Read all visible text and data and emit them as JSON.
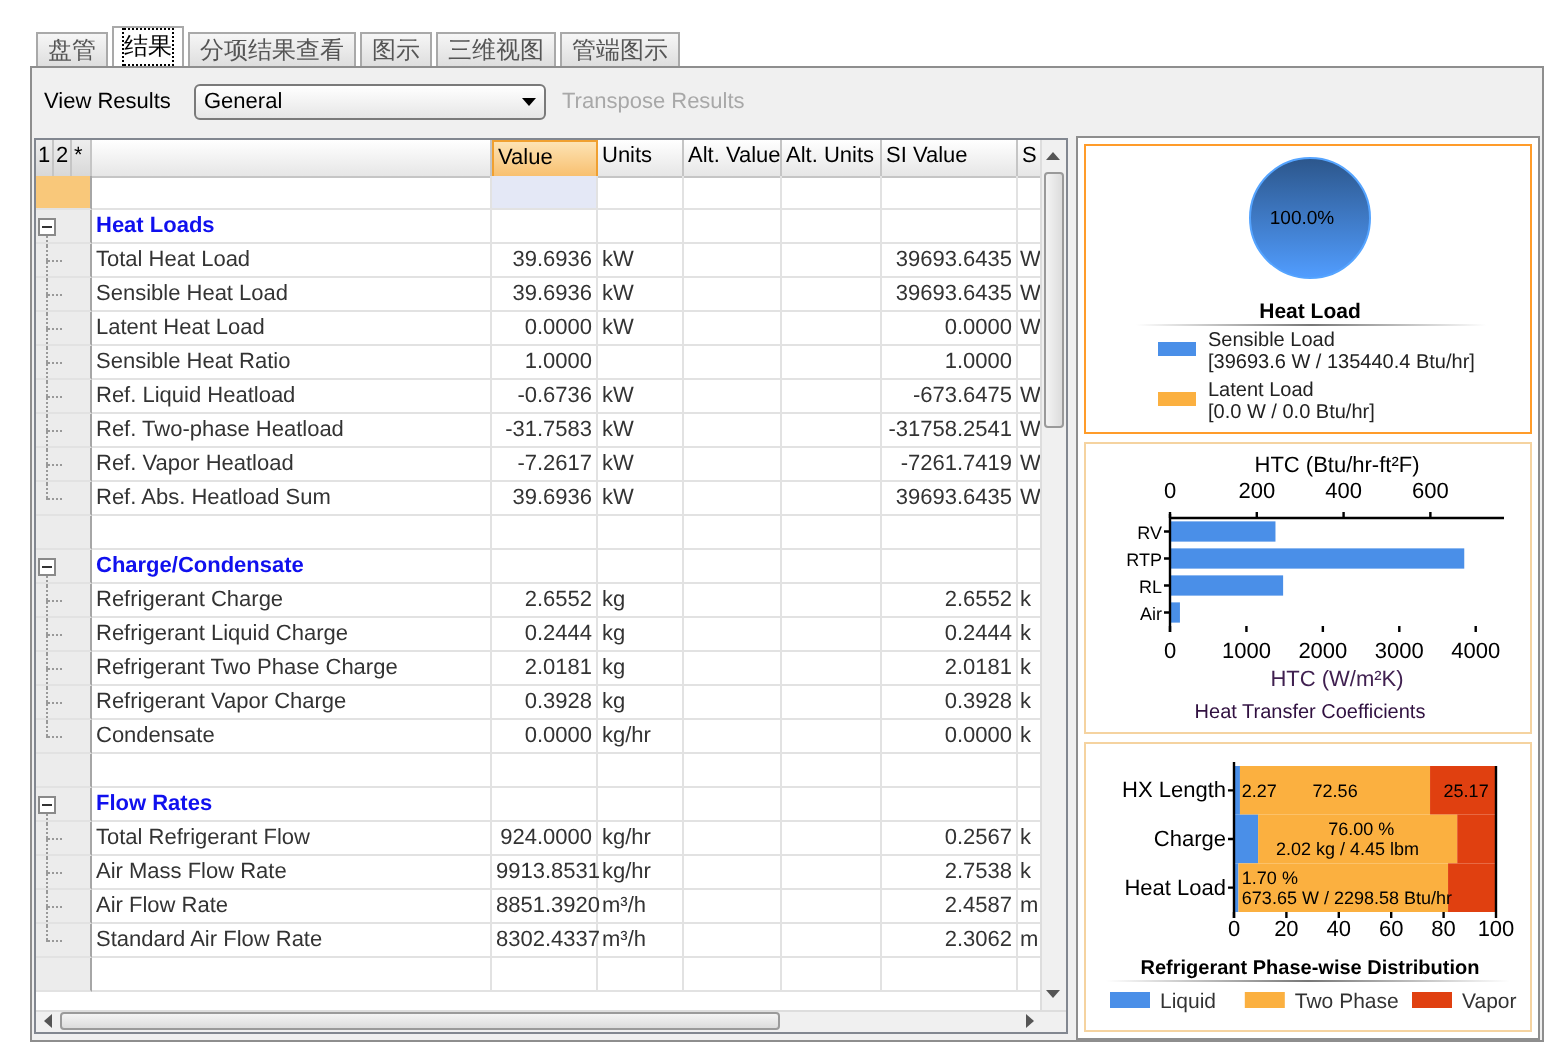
{
  "tabs": [
    {
      "label": "盘管",
      "selected": false
    },
    {
      "label": "结果",
      "selected": true
    },
    {
      "label": "分项结果查看",
      "selected": false
    },
    {
      "label": "图示",
      "selected": false
    },
    {
      "label": "三维视图",
      "selected": false
    },
    {
      "label": "管端图示",
      "selected": false
    }
  ],
  "toolbar": {
    "label": "View Results",
    "dropdown": {
      "value": "General"
    },
    "transpose_button": {
      "label": "Transpose Results",
      "disabled": true
    }
  },
  "grid": {
    "gutter_headers": [
      "1",
      "2",
      "*"
    ],
    "columns": [
      {
        "label": "Value",
        "selected": true
      },
      {
        "label": "Units",
        "selected": false
      },
      {
        "label": "Alt. Value",
        "selected": false
      },
      {
        "label": "Alt. Units",
        "selected": false
      },
      {
        "label": "SI Value",
        "selected": false
      },
      {
        "label": "S",
        "selected": false
      }
    ],
    "leading_row": {
      "selected": true
    },
    "sections": [
      {
        "title": "Heat Loads",
        "expanded": true,
        "rows": [
          {
            "name": "Total Heat Load",
            "value": "39.6936",
            "units": "kW",
            "si_value": "39693.6435",
            "si_units": "W"
          },
          {
            "name": "Sensible Heat Load",
            "value": "39.6936",
            "units": "kW",
            "si_value": "39693.6435",
            "si_units": "W"
          },
          {
            "name": "Latent Heat Load",
            "value": "0.0000",
            "units": "kW",
            "si_value": "0.0000",
            "si_units": "W"
          },
          {
            "name": "Sensible Heat Ratio",
            "value": "1.0000",
            "si_value": "1.0000"
          },
          {
            "name": "Ref. Liquid Heatload",
            "value": "-0.6736",
            "units": "kW",
            "si_value": "-673.6475",
            "si_units": "W"
          },
          {
            "name": "Ref. Two-phase Heatload",
            "value": "-31.7583",
            "units": "kW",
            "si_value": "-31758.2541",
            "si_units": "W"
          },
          {
            "name": "Ref. Vapor Heatload",
            "value": "-7.2617",
            "units": "kW",
            "si_value": "-7261.7419",
            "si_units": "W"
          },
          {
            "name": "Ref. Abs. Heatload Sum",
            "value": "39.6936",
            "units": "kW",
            "si_value": "39693.6435",
            "si_units": "W"
          }
        ]
      },
      {
        "title": "Charge/Condensate",
        "expanded": true,
        "rows": [
          {
            "name": "Refrigerant Charge",
            "value": "2.6552",
            "units": "kg",
            "si_value": "2.6552",
            "si_units": "k"
          },
          {
            "name": "Refrigerant Liquid Charge",
            "value": "0.2444",
            "units": "kg",
            "si_value": "0.2444",
            "si_units": "k"
          },
          {
            "name": "Refrigerant Two Phase Charge",
            "value": "2.0181",
            "units": "kg",
            "si_value": "2.0181",
            "si_units": "k"
          },
          {
            "name": "Refrigerant Vapor Charge",
            "value": "0.3928",
            "units": "kg",
            "si_value": "0.3928",
            "si_units": "k"
          },
          {
            "name": "Condensate",
            "value": "0.0000",
            "units": "kg/hr",
            "si_value": "0.0000",
            "si_units": "k"
          }
        ]
      },
      {
        "title": "Flow Rates",
        "expanded": true,
        "rows": [
          {
            "name": "Total Refrigerant Flow",
            "value": "924.0000",
            "units": "kg/hr",
            "si_value": "0.2567",
            "si_units": "k"
          },
          {
            "name": "Air Mass Flow Rate",
            "value": "9913.8531",
            "units": "kg/hr",
            "si_value": "2.7538",
            "si_units": "k"
          },
          {
            "name": "Air Flow Rate",
            "value": "8851.3920",
            "units": "m³/h",
            "si_value": "2.4587",
            "si_units": "m"
          },
          {
            "name": "Standard Air Flow Rate",
            "value": "8302.4337",
            "units": "m³/h",
            "si_value": "2.3062",
            "si_units": "m"
          }
        ]
      }
    ]
  },
  "charts": [
    {
      "selected": true,
      "chart_data": {
        "type": "pie",
        "title": "Heat Load",
        "categories": [
          "Sensible Load",
          "Latent Load"
        ],
        "values": [
          100.0,
          0.0
        ],
        "annotations": [
          {
            "text": "100.0%"
          }
        ]
      },
      "legend": [
        {
          "detail": "[39693.6 W / 135440.4 Btu/hr]",
          "color": "#4a8fe8"
        },
        {
          "detail": "[0.0 W / 0.0 Btu/hr]",
          "color": "#fbb040"
        }
      ]
    },
    {
      "selected": false,
      "chart_data": {
        "type": "bar",
        "orientation": "horizontal",
        "title": "Heat Transfer Coefficients",
        "xlabel": "HTC (W/m²K)",
        "categories": [
          "RV",
          "RTP",
          "RL",
          "Air"
        ],
        "series": [
          {
            "color": "#4a8fe8",
            "values": [
              1380,
              3850,
              1480,
              130
            ]
          }
        ],
        "xlim": [
          0,
          4370
        ],
        "xticks": [
          {
            "value": 0,
            "label": "0"
          },
          {
            "value": 1000,
            "label": "1000"
          },
          {
            "value": 2000,
            "label": "2000"
          },
          {
            "value": 3000,
            "label": "3000"
          },
          {
            "value": 4000,
            "label": "4000"
          }
        ]
      },
      "top_axis": {
        "label": "HTC (Btu/hr-ft²F)",
        "ticks": [
          "0",
          "200",
          "400",
          "600"
        ]
      }
    },
    {
      "selected": false,
      "chart_data": {
        "type": "bar",
        "orientation": "horizontal",
        "stacked": true,
        "title": "Refrigerant Phase-wise Distribution",
        "categories": [
          "HX Length",
          "Charge",
          "Heat Load"
        ],
        "series": [
          {
            "name": "Liquid",
            "color": "#4a8fe8",
            "values": [
              2.27,
              9.2,
              1.7
            ]
          },
          {
            "name": "Two Phase",
            "color": "#fbb040",
            "values": [
              72.56,
              76.0,
              80.0
            ]
          },
          {
            "name": "Vapor",
            "color": "#e04010",
            "values": [
              25.17,
              14.8,
              18.3
            ]
          }
        ],
        "xlim": [
          0,
          100
        ],
        "xticks": [
          {
            "value": 0,
            "label": "0"
          },
          {
            "value": 20,
            "label": "20"
          },
          {
            "value": 40,
            "label": "40"
          },
          {
            "value": 60,
            "label": "60"
          },
          {
            "value": 80,
            "label": "80"
          },
          {
            "value": 100,
            "label": "100"
          }
        ],
        "legend": "bottom",
        "annotations": [
          {
            "x": 3,
            "y": "HX Length",
            "text": "2.27"
          },
          {
            "x": 30,
            "y": "HX Length",
            "text": "72.56"
          },
          {
            "x": 80,
            "y": "HX Length",
            "text": "25.17"
          },
          {
            "x": 36,
            "y": "Charge",
            "text": "76.00 %"
          },
          {
            "x": 16,
            "y": "Charge",
            "text": "2.02 kg / 4.45 lbm"
          },
          {
            "x": 3,
            "y": "Heat Load",
            "text": "1.70 %"
          },
          {
            "x": 3,
            "y": "Heat Load",
            "text": "673.65 W / 2298.58 Btu/hr"
          }
        ]
      }
    }
  ]
}
